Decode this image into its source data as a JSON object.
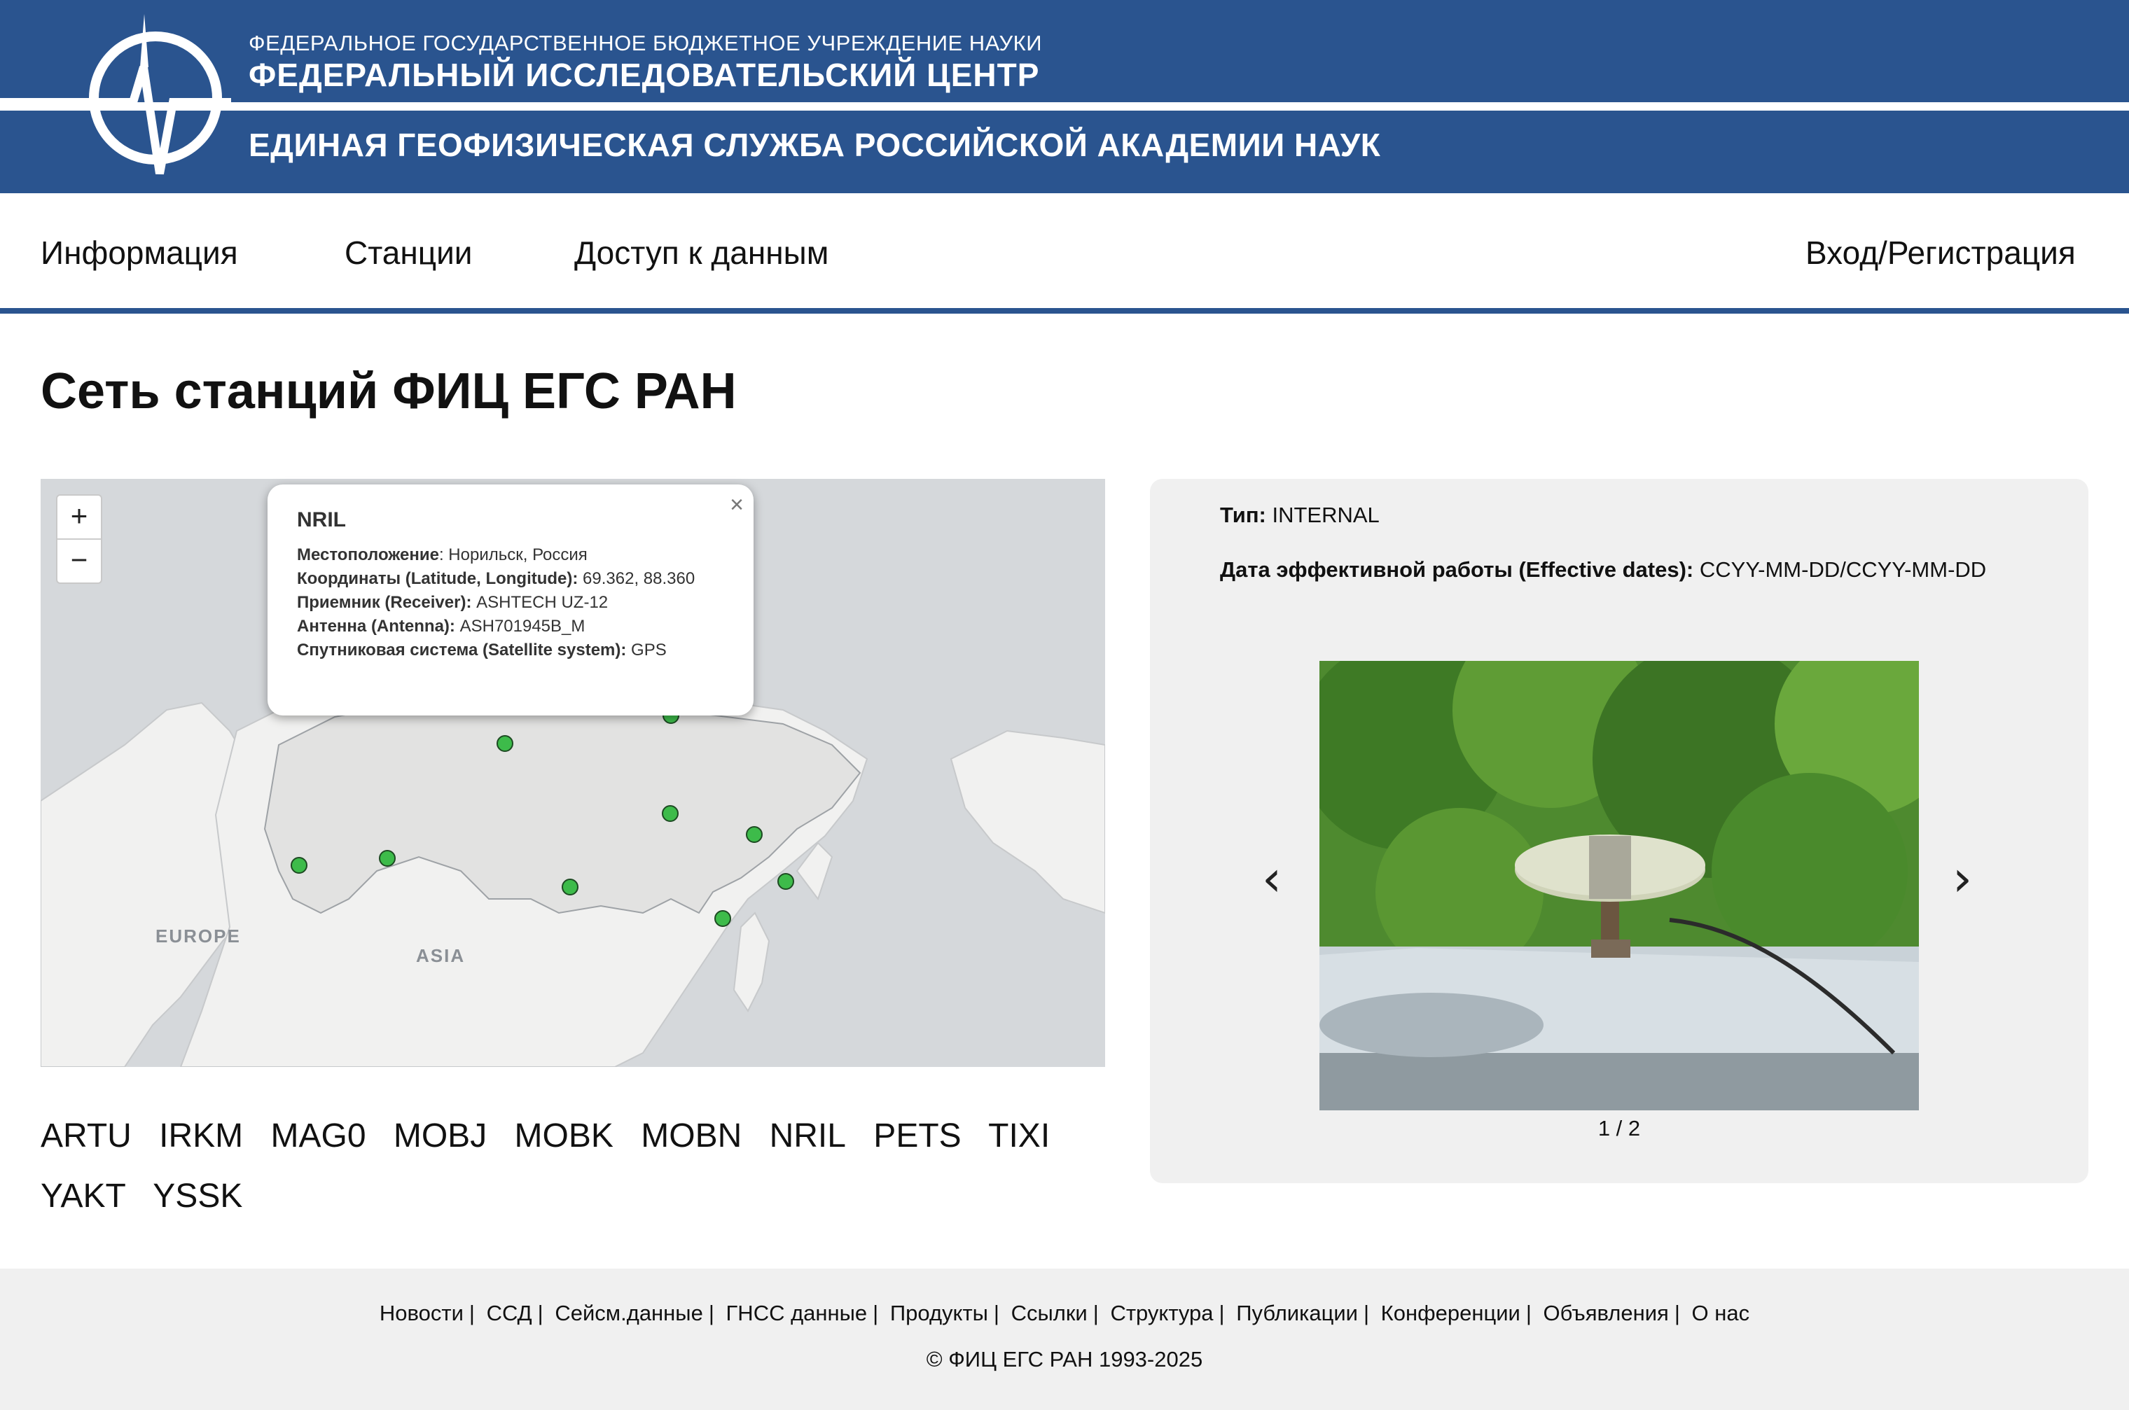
{
  "header": {
    "line1": "ФЕДЕРАЛЬНОЕ ГОСУДАРСТВЕННОЕ БЮДЖЕТНОЕ УЧРЕЖДЕНИЕ НАУКИ",
    "line2": "ФЕДЕРАЛЬНЫЙ ИССЛЕДОВАТЕЛЬСКИЙ ЦЕНТР",
    "line3": "ЕДИНАЯ ГЕОФИЗИЧЕСКАЯ СЛУЖБА РОССИЙСКОЙ АКАДЕМИИ НАУК",
    "brand_color": "#2a548f"
  },
  "nav": {
    "items": [
      "Информация",
      "Станции",
      "Доступ к данным"
    ],
    "login": "Вход/Регистрация"
  },
  "page": {
    "title": "Сеть станций ФИЦ ЕГС РАН"
  },
  "map": {
    "zoom_in": "+",
    "zoom_out": "−",
    "labels": {
      "europe": "EUROPE",
      "asia": "ASIA"
    },
    "marker_color": "#3dbb4a",
    "popup": {
      "title": "NRIL",
      "close": "×",
      "location_label": "Местоположение",
      "location_value": ": Норильск, Россия",
      "coords_label": "Координаты (Latitude, Longitude):",
      "coords_value": " 69.362, 88.360",
      "receiver_label": "Приемник (Receiver):",
      "receiver_value": " ASHTECH UZ-12",
      "antenna_label": "Антенна (Antenna):",
      "antenna_value": " ASH701945B_M",
      "satellite_label": "Спутниковая система (Satellite system):",
      "satellite_value": " GPS"
    }
  },
  "stations": [
    "ARTU",
    "IRKM",
    "MAG0",
    "MOBJ",
    "MOBK",
    "MOBN",
    "NRIL",
    "PETS",
    "TIXI",
    "YAKT",
    "YSSK"
  ],
  "details": {
    "type_label": "Тип:",
    "type_value": " INTERNAL",
    "dates_label": "Дата эффективной работы (Effective dates):",
    "dates_value": " CCYY-MM-DD/CCYY-MM-DD",
    "prev_icon": "chevron-left-icon",
    "next_icon": "chevron-right-icon",
    "counter": "1 / 2"
  },
  "footer": {
    "links": [
      "Новости",
      "ССД",
      "Сейсм.данные",
      "ГНСС данные",
      "Продукты",
      "Ссылки",
      "Структура",
      "Публикации",
      "Конференции",
      "Объявления",
      "О нас"
    ],
    "separator": "|",
    "copyright": "© ФИЦ ЕГС РАН 1993-2025"
  }
}
